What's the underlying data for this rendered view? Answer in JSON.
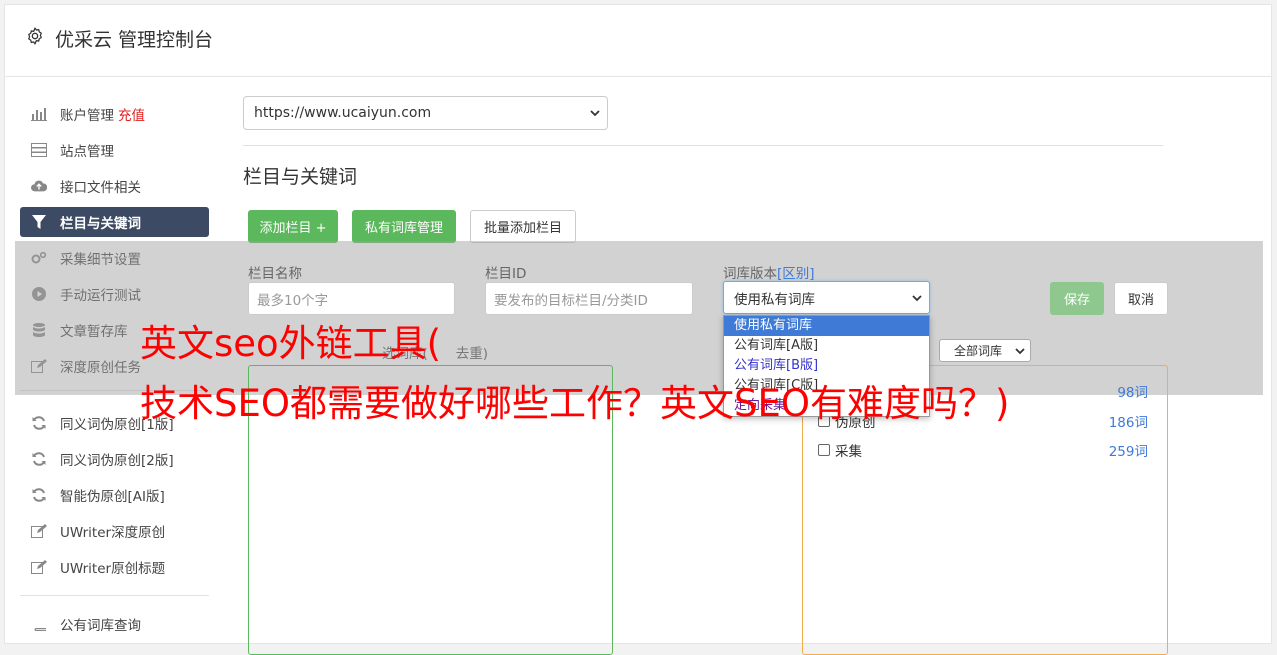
{
  "header": {
    "title": "优采云 管理控制台"
  },
  "sidebar": {
    "items": [
      {
        "label": "账户管理",
        "extra": "充值"
      },
      {
        "label": "站点管理"
      },
      {
        "label": "接口文件相关"
      },
      {
        "label": "栏目与关键词"
      },
      {
        "label": "采集细节设置"
      },
      {
        "label": "手动运行测试"
      },
      {
        "label": "文章暂存库"
      },
      {
        "label": "深度原创任务"
      },
      {
        "label": "同义词伪原创[1版]"
      },
      {
        "label": "同义词伪原创[2版]"
      },
      {
        "label": "智能伪原创[AI版]"
      },
      {
        "label": "UWriter深度原创"
      },
      {
        "label": "UWriter原创标题"
      },
      {
        "label": "公有词库查询"
      }
    ]
  },
  "main": {
    "url_select": "https://www.ucaiyun.com",
    "section_title": "栏目与关键词",
    "buttons": {
      "add_column": "添加栏目 +",
      "private_lib": "私有词库管理",
      "batch_add": "批量添加栏目"
    },
    "form": {
      "col_name_label": "栏目名称",
      "col_name_placeholder": "最多10个字",
      "col_id_label": "栏目ID",
      "col_id_placeholder": "要发布的目标栏目/分类ID",
      "lib_version_label": "词库版本",
      "lib_version_link": "[区别]",
      "lib_version_value": "使用私有词库",
      "save": "保存",
      "cancel": "取消",
      "selected_lib_label": "选词库(",
      "selected_lib_tail": "去重)"
    },
    "dropdown_options": [
      "使用私有词库",
      "公有词库[A版]",
      "公有词库[B版]",
      "公有词库[C版]",
      "定向采集"
    ],
    "all_lib_select": "全部词库",
    "lib_rows": [
      {
        "name": "",
        "count": "98词"
      },
      {
        "name": "伪原创",
        "count": "186词"
      },
      {
        "name": "采集",
        "count": "259词"
      }
    ]
  },
  "watermark": {
    "line1": "英文seo外链工具(",
    "line2": "技术SEO都需要做好哪些工作？英文SEO有难度吗？)"
  },
  "colors": {
    "accent": "#3c4a63",
    "green": "#5cb85c",
    "watermark": "#ff0000"
  }
}
